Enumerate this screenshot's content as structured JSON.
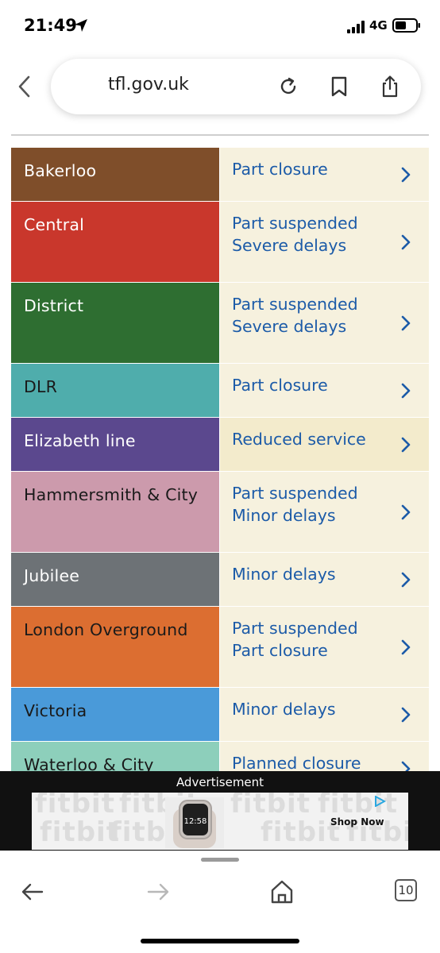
{
  "status_bar": {
    "time": "21:49",
    "network": "4G"
  },
  "browser": {
    "url": "tfl.gov.uk"
  },
  "lines": [
    {
      "name": "Bakerloo",
      "status": [
        "Part closure"
      ],
      "color": "#7f4e2a",
      "dark_text": false
    },
    {
      "name": "Central",
      "status": [
        "Part suspended",
        "Severe delays"
      ],
      "color": "#c9372c",
      "dark_text": false
    },
    {
      "name": "District",
      "status": [
        "Part suspended",
        "Severe delays"
      ],
      "color": "#2e6e31",
      "dark_text": false
    },
    {
      "name": "DLR",
      "status": [
        "Part closure"
      ],
      "color": "#4fadac",
      "dark_text": true
    },
    {
      "name": "Elizabeth line",
      "status": [
        "Reduced service"
      ],
      "color": "#5b488e",
      "dark_text": false
    },
    {
      "name": "Hammersmith & City",
      "status": [
        "Part suspended",
        "Minor delays"
      ],
      "color": "#cc9aac",
      "dark_text": true
    },
    {
      "name": "Jubilee",
      "status": [
        "Minor delays"
      ],
      "color": "#6d7276",
      "dark_text": false
    },
    {
      "name": "London Overground",
      "status": [
        "Part suspended",
        "Part closure"
      ],
      "color": "#dc6e31",
      "dark_text": true
    },
    {
      "name": "Victoria",
      "status": [
        "Minor delays"
      ],
      "color": "#4a9ad9",
      "dark_text": true
    },
    {
      "name": "Waterloo & City",
      "status": [
        "Planned closure"
      ],
      "color": "#8dcfbb",
      "dark_text": true
    }
  ],
  "advertisement": {
    "label": "Advertisement",
    "brand": "fitbit",
    "watch_time": "12:58",
    "cta": "Shop Now"
  },
  "toolbar": {
    "tab_count": "10"
  }
}
